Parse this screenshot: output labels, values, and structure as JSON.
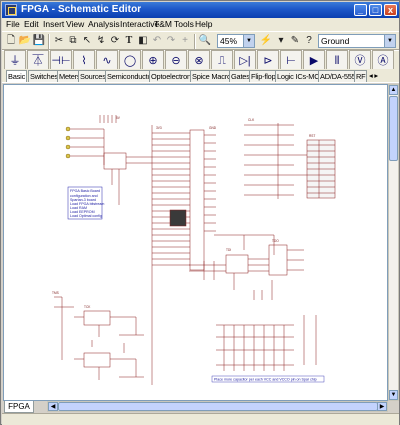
{
  "window": {
    "title": "FPGA - Schematic Editor"
  },
  "titlebar_buttons": [
    "_",
    "□",
    "x"
  ],
  "menu": [
    "File",
    "Edit",
    "Insert",
    "View",
    "Analysis",
    "Interactive",
    "T&M",
    "Tools",
    "Help"
  ],
  "toolbar": {
    "zoom": "45%",
    "component": "Ground"
  },
  "categories": [
    "Basic",
    "Switches",
    "Meters",
    "Sources",
    "Semiconductors",
    "Optoelectronic",
    "Spice Macros",
    "Gates",
    "Flip-flops",
    "Logic ICs-MCUs",
    "AD/DA-555",
    "RF"
  ],
  "active_category": "Basic",
  "sheet_tab": "FPGA",
  "schematic": {
    "net_labels": [
      "5V",
      "3V3",
      "GND",
      "CLK",
      "RST",
      "TDI",
      "TDO",
      "TMS",
      "TCK"
    ],
    "description_box": [
      "FPGA Basic Board",
      "configuration and",
      "Spartan-3 board",
      "Load FPGA bitstream",
      "Load RAM",
      "Load EEPROM",
      "Load Optimal config"
    ],
    "bottom_note": "Place more capacitor per each VCC and VCCO pin on Spar chip"
  }
}
